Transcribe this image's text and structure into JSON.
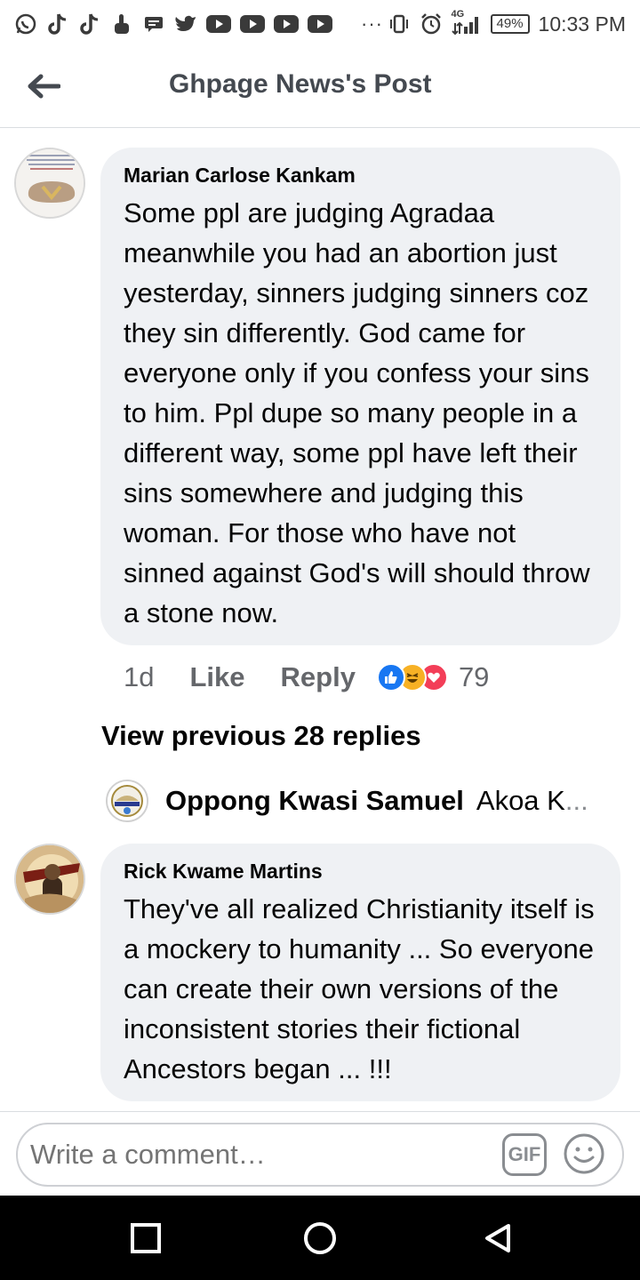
{
  "status_bar": {
    "network": "4G",
    "battery": "49%",
    "time": "10:33 PM",
    "overflow": "···"
  },
  "header": {
    "title": "Ghpage News's Post"
  },
  "comments": [
    {
      "author": "Marian Carlose Kankam",
      "text": "Some ppl are judging Agradaa meanwhile you had an abortion just yesterday, sinners judging sinners coz they sin differently. God came for everyone only if you confess your sins to him. Ppl dupe so many people in a different way, some ppl have left their sins somewhere and judging this woman. For those who have not sinned against God's will should throw a stone now.",
      "time": "1d",
      "like_label": "Like",
      "reply_label": "Reply",
      "reaction_count": "79",
      "reactions": [
        "like-icon",
        "haha-icon",
        "love-icon"
      ]
    },
    {
      "author": "Rick Kwame Martins",
      "text": "They've all realized Christianity itself is a mockery to humanity ... So everyone can create their own versions of the inconsistent stories their fictional Ancestors began ... !!!"
    }
  ],
  "view_previous": "View previous 28 replies",
  "reply_preview": {
    "name": "Oppong Kwasi Samuel",
    "text": "Akoa K",
    "ellipsis": "..."
  },
  "composer": {
    "placeholder": "Write a comment…",
    "gif_label": "GIF"
  },
  "colors": {
    "bubble": "#eff1f4",
    "secondary_text": "#65676b",
    "like_blue": "#1877f2",
    "haha_yellow": "#f7b125",
    "love_red": "#f33e58"
  }
}
